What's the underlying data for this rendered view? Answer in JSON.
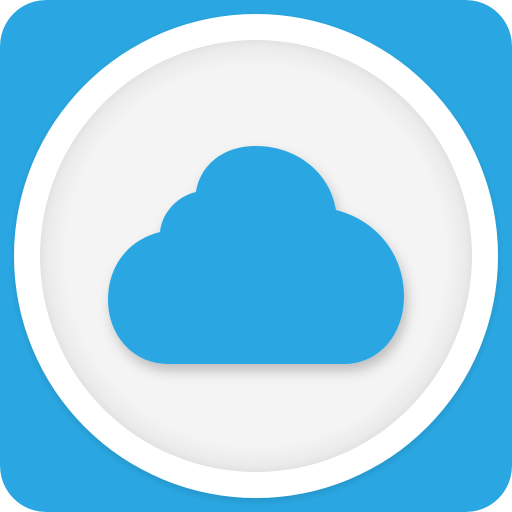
{
  "app_icon": {
    "icon": "cloud-icon",
    "colors": {
      "tile_background": "#2AA7E2",
      "outer_ring": "#FFFFFF",
      "inner_disc": "#F2F2F2",
      "cloud": "#2AA7E2"
    }
  }
}
